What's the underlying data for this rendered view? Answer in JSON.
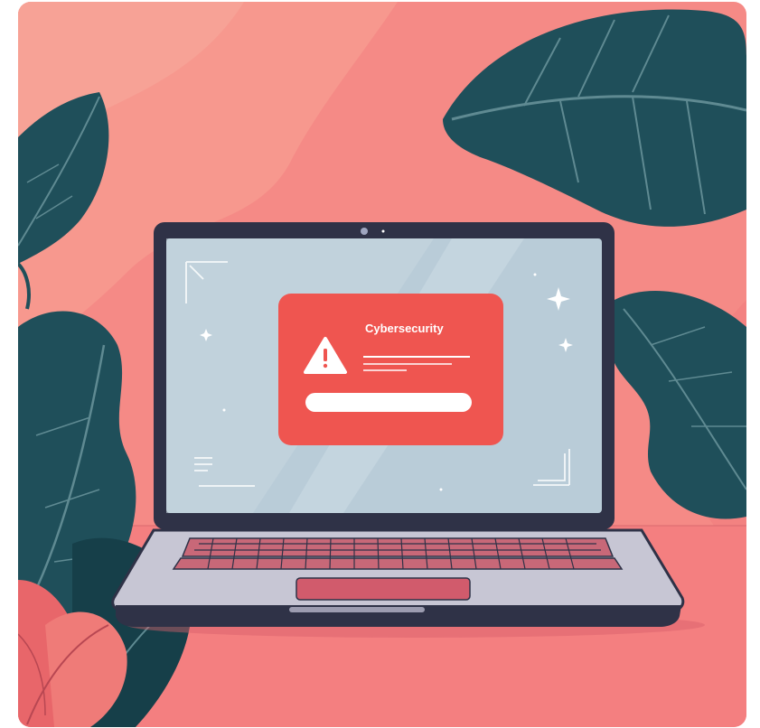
{
  "illustration": {
    "colors": {
      "background": "#f58a86",
      "background_light": "#f7a093",
      "leaf": "#1f4f5a",
      "leaf_dark": "#163f49",
      "leaf_pink": "#e8666a",
      "laptop_frame": "#2f3247",
      "screen": "#b9ccd8",
      "alert": "#ef5550",
      "keyboard": "#c86878",
      "deck": "#c7c6d4"
    },
    "alert": {
      "title": "Cybersecurity",
      "icon": "warning-icon"
    }
  }
}
